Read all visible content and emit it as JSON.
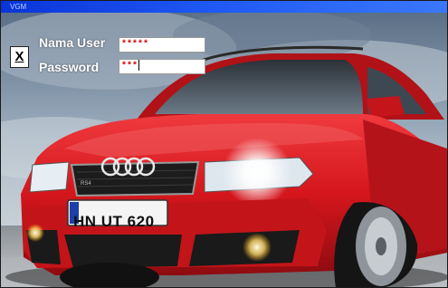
{
  "window": {
    "title": "VGM"
  },
  "login": {
    "close_label": "X",
    "username_label": "Nama User",
    "username_value": "*****",
    "password_label": "Password",
    "password_value": "***"
  },
  "background": {
    "plate_text": "HN UT 620",
    "car_color": "#d8161c",
    "sky_color": "#8fa1b3"
  }
}
